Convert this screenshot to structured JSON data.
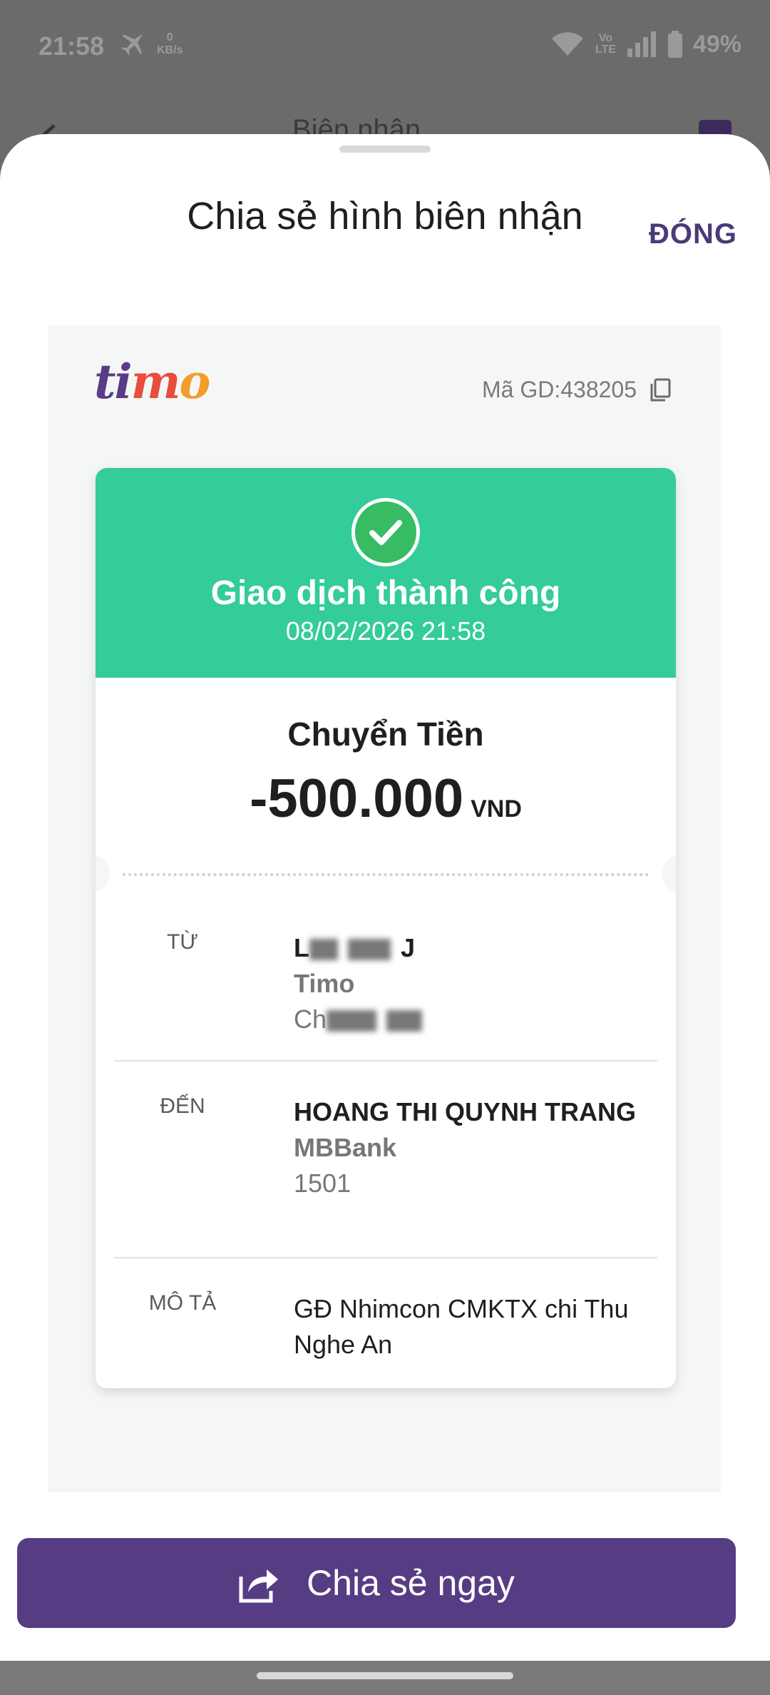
{
  "status_bar": {
    "time": "21:58",
    "net_speed_value": "0",
    "net_speed_unit": "KB/s",
    "volte_top": "Vo",
    "volte_bottom": "LTE",
    "battery": "49%"
  },
  "background_page": {
    "title": "Biên nhận"
  },
  "sheet": {
    "title": "Chia sẻ hình biên nhận",
    "close_label": "ĐÓNG"
  },
  "receipt": {
    "brand": [
      "t",
      "i",
      "m",
      "o"
    ],
    "transaction_id_label": "Mã GD:438205",
    "status_title": "Giao dịch thành công",
    "status_datetime": "08/02/2026 21:58",
    "type_label": "Chuyển Tiền",
    "amount": "-500.000",
    "currency": "VND",
    "from": {
      "label": "TỪ",
      "name_visible": "L",
      "name_end": "J",
      "bank": "Timo",
      "account_visible": "Ch"
    },
    "to": {
      "label": "ĐẾN",
      "name": "HOANG THI QUYNH TRANG",
      "bank": "MBBank",
      "account": "1501"
    },
    "description": {
      "label": "MÔ TẢ",
      "text": "GĐ Nhimcon CMKTX chi Thu Nghe An"
    }
  },
  "share_button": {
    "label": "Chia sẻ ngay"
  },
  "colors": {
    "brand_purple": "#563d83",
    "success_green": "#33cc9a",
    "check_green": "#37bb63"
  }
}
